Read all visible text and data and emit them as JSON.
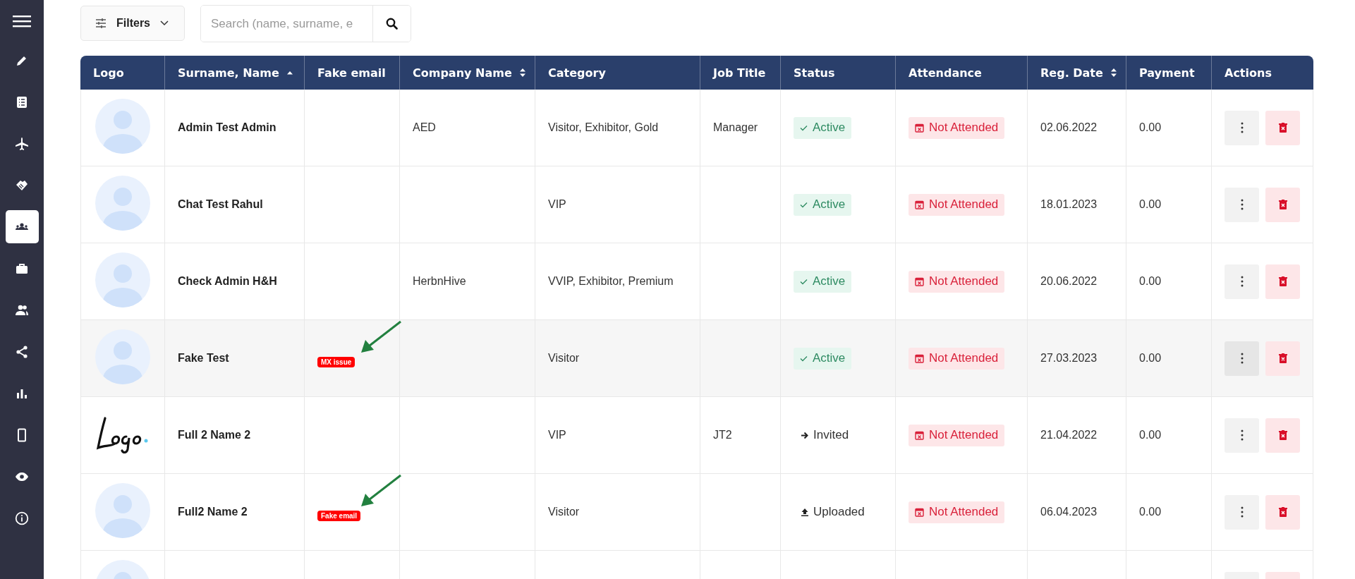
{
  "sidebar": {
    "items": [
      {
        "selected": false
      },
      {
        "selected": false
      },
      {
        "selected": false
      },
      {
        "selected": false
      },
      {
        "selected": true
      },
      {
        "selected": false
      },
      {
        "selected": false
      },
      {
        "selected": false
      },
      {
        "selected": false
      },
      {
        "selected": false
      },
      {
        "selected": false
      },
      {
        "selected": false
      }
    ]
  },
  "toolbar": {
    "filters_label": "Filters",
    "search": {
      "placeholder": "Search (name, surname, e"
    }
  },
  "table": {
    "columns": [
      {
        "label": "Logo"
      },
      {
        "label": "Surname, Name",
        "sort": {
          "kind": "asc"
        }
      },
      {
        "label": "Fake email"
      },
      {
        "label": "Company Name",
        "sort": {
          "kind": "both"
        }
      },
      {
        "label": "Category"
      },
      {
        "label": "Job Title"
      },
      {
        "label": "Status"
      },
      {
        "label": "Attendance"
      },
      {
        "label": "Reg. Date",
        "sort": {
          "kind": "both"
        }
      },
      {
        "label": "Payment"
      },
      {
        "label": "Actions"
      }
    ],
    "rows": [
      {
        "logo": {
          "kind": "avatar"
        },
        "name": "Admin Test Admin",
        "company": "AED",
        "category": "Visitor, Exhibitor, Gold",
        "job_title": "Manager",
        "status": {
          "kind": "active",
          "label": "Active"
        },
        "attendance": {
          "kind": "not_attended",
          "label": "Not Attended"
        },
        "reg_date": "02.06.2022",
        "payment": "0.00",
        "highlighted": false
      },
      {
        "logo": {
          "kind": "avatar"
        },
        "name": "Chat Test Rahul",
        "category": "VIP",
        "status": {
          "kind": "active",
          "label": "Active"
        },
        "attendance": {
          "kind": "not_attended",
          "label": "Not Attended"
        },
        "reg_date": "18.01.2023",
        "payment": "0.00",
        "highlighted": false
      },
      {
        "logo": {
          "kind": "avatar"
        },
        "name": "Check Admin H&H",
        "company": "HerbnHive",
        "category": "VVIP, Exhibitor, Premium",
        "status": {
          "kind": "active",
          "label": "Active"
        },
        "attendance": {
          "kind": "not_attended",
          "label": "Not Attended"
        },
        "reg_date": "20.06.2022",
        "payment": "0.00",
        "highlighted": false
      },
      {
        "logo": {
          "kind": "avatar"
        },
        "name": "Fake Test",
        "fake_email": {
          "label": "MX issue",
          "arrow": true
        },
        "category": "Visitor",
        "status": {
          "kind": "active",
          "label": "Active"
        },
        "attendance": {
          "kind": "not_attended",
          "label": "Not Attended"
        },
        "reg_date": "27.03.2023",
        "payment": "0.00",
        "highlighted": true
      },
      {
        "logo": {
          "kind": "image"
        },
        "name": "Full 2 Name 2",
        "category": "VIP",
        "job_title": "JT2",
        "status": {
          "kind": "invited",
          "label": "Invited"
        },
        "attendance": {
          "kind": "not_attended",
          "label": "Not Attended"
        },
        "reg_date": "21.04.2022",
        "payment": "0.00",
        "highlighted": false
      },
      {
        "logo": {
          "kind": "avatar"
        },
        "name": "Full2 Name 2",
        "fake_email": {
          "label": "Fake email",
          "arrow": true
        },
        "category": "Visitor",
        "status": {
          "kind": "uploaded",
          "label": "Uploaded"
        },
        "attendance": {
          "kind": "not_attended",
          "label": "Not Attended"
        },
        "reg_date": "06.04.2023",
        "payment": "0.00",
        "highlighted": false
      },
      {
        "logo": {
          "kind": "avatar"
        },
        "highlighted": false
      }
    ]
  }
}
